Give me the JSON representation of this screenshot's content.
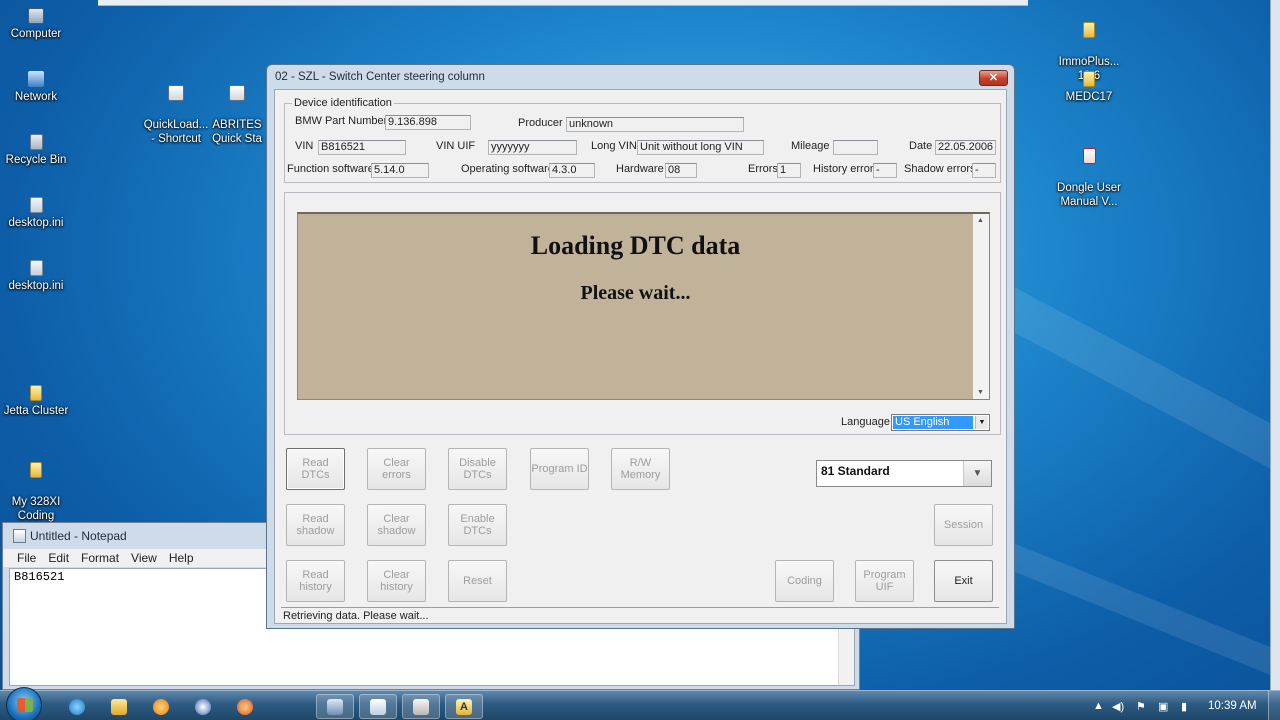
{
  "desktop": {
    "icons": [
      {
        "label": "Computer",
        "icon": "computer-icon"
      },
      {
        "label": "Network",
        "icon": "network-icon"
      },
      {
        "label": "Recycle Bin",
        "icon": "recycle-bin-icon"
      },
      {
        "label": "desktop.ini",
        "icon": "file-icon"
      },
      {
        "label": "desktop.ini",
        "icon": "file-icon"
      },
      {
        "label": "QuickLoad...\n- Shortcut",
        "icon": "shortcut-icon"
      },
      {
        "label": "ABRITES\nQuick Sta",
        "icon": "shortcut-icon"
      },
      {
        "label": "Jetta Cluster",
        "icon": "folder-icon"
      },
      {
        "label": "My 328XI\nCoding",
        "icon": "folder-icon"
      },
      {
        "label": "ImmoPlus...\n13.6",
        "icon": "folder-icon"
      },
      {
        "label": "MEDC17",
        "icon": "folder-icon"
      },
      {
        "label": "Dongle User\nManual V...",
        "icon": "pdf-icon"
      }
    ]
  },
  "notepad": {
    "title": "Untitled - Notepad",
    "menu": [
      "File",
      "Edit",
      "Format",
      "View",
      "Help"
    ],
    "content": "B816521"
  },
  "dialog": {
    "title": "02 - SZL - Switch Center steering column",
    "group_label": "Device identification",
    "fields": {
      "bmw_part_number": {
        "label": "BMW Part Number",
        "value": "9.136.898"
      },
      "producer": {
        "label": "Producer",
        "value": "unknown"
      },
      "vin": {
        "label": "VIN",
        "value": "B816521"
      },
      "vin_uif": {
        "label": "VIN UIF",
        "value": "yyyyyyy"
      },
      "long_vin": {
        "label": "Long VIN",
        "value": "Unit without long VIN"
      },
      "mileage": {
        "label": "Mileage",
        "value": ""
      },
      "date": {
        "label": "Date",
        "value": "22.05.2006"
      },
      "function_software": {
        "label": "Function software",
        "value": "5.14.0"
      },
      "operating_software": {
        "label": "Operating software",
        "value": "4.3.0"
      },
      "hardware": {
        "label": "Hardware",
        "value": "08"
      },
      "errors": {
        "label": "Errors",
        "value": "1"
      },
      "history_errors": {
        "label": "History errors",
        "value": "-"
      },
      "shadow_errors": {
        "label": "Shadow errors",
        "value": "-"
      }
    },
    "message": {
      "title": "Loading DTC data",
      "subtitle": "Please wait..."
    },
    "language": {
      "label": "Language:",
      "value": "US English"
    },
    "standard_combo": "81 Standard",
    "buttons": {
      "read_dtcs": "Read\nDTCs",
      "clear_errors": "Clear errors",
      "disable_dtcs": "Disable\nDTCs",
      "program_id": "Program ID",
      "rw_memory": "R/W\nMemory",
      "read_shadow": "Read\nshadow",
      "clear_shadow": "Clear\nshadow",
      "enable_dtcs": "Enable\nDTCs",
      "session": "Session",
      "read_history": "Read\nhistory",
      "clear_history": "Clear\nhistory",
      "reset": "Reset",
      "coding": "Coding",
      "program_uif": "Program\nUIF",
      "exit": "Exit"
    },
    "status": "Retrieving data. Please wait..."
  },
  "taskbar": {
    "clock": "10:39 AM"
  }
}
